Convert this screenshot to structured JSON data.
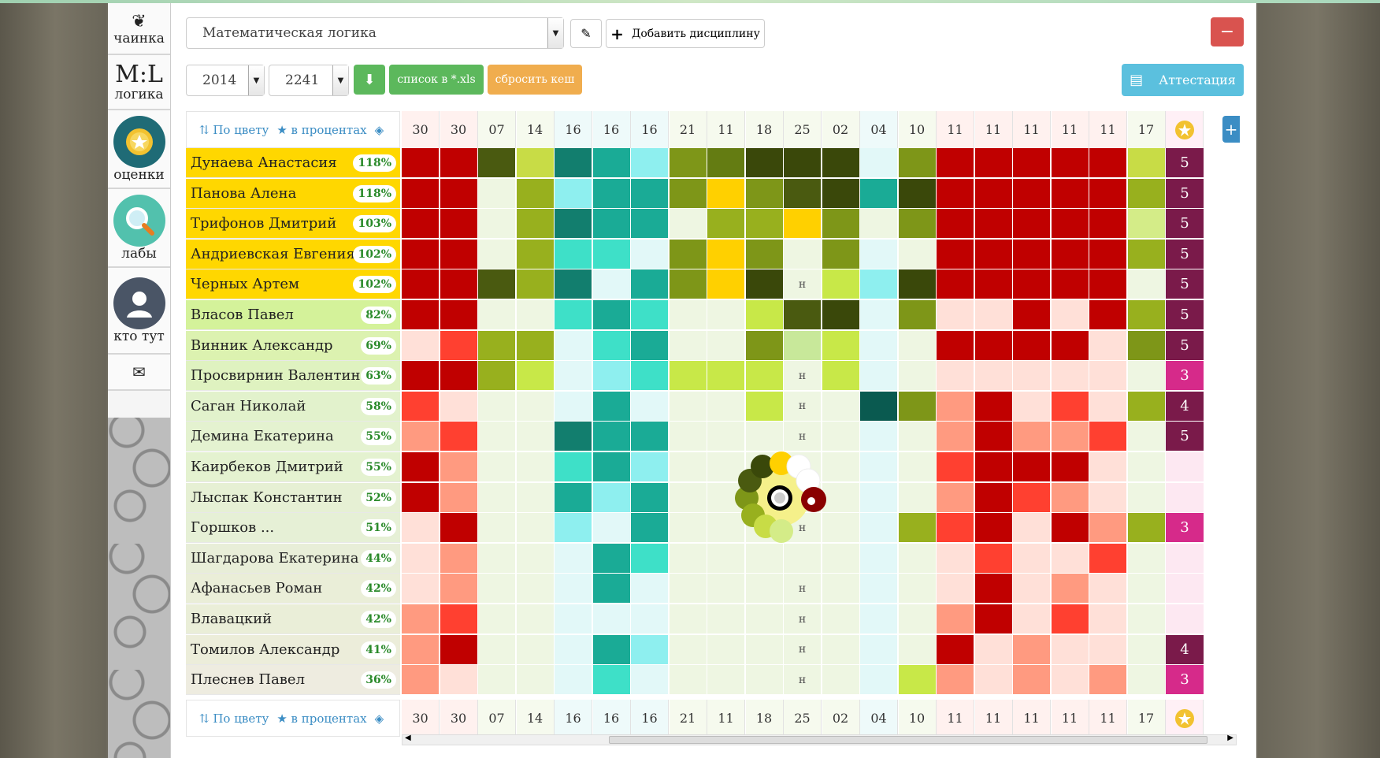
{
  "sidebar": {
    "items": [
      {
        "label": "чаинка",
        "icon": "leaf-icon"
      },
      {
        "label": "логика",
        "logo": "M:L"
      },
      {
        "label": "оценки",
        "icon": "medal-icon"
      },
      {
        "label": "лабы",
        "icon": "magnifier-icon"
      },
      {
        "label": "кто тут",
        "icon": "user-icon"
      },
      {
        "label": "",
        "icon": "mail-icon"
      }
    ]
  },
  "toolbar": {
    "discipline": "Математическая логика",
    "add_discipline": "Добавить дисциплину",
    "remove_label": "−",
    "year": "2014",
    "group": "2241",
    "export_xls": "список в *.xls",
    "reset_cache": "сбросить кеш",
    "attestation": "Аттестация"
  },
  "table_tools": {
    "by_color": "По цвету",
    "in_percent": "в процентах"
  },
  "dates": [
    "30",
    "30",
    "07",
    "14",
    "16",
    "16",
    "16",
    "21",
    "11",
    "18",
    "25",
    "02",
    "04",
    "10",
    "11",
    "11",
    "11",
    "11",
    "11",
    "17"
  ],
  "colors": {
    "accent_green": "#5cb85c",
    "accent_orange": "#f0ad4e",
    "accent_blue": "#5bc0de",
    "danger": "#d9534f",
    "highlight_row": "#ffd700"
  },
  "students": [
    {
      "name": "Дунаева Анастасия",
      "pct": "118%",
      "bg": "#ffd700",
      "final": "5",
      "cells": [
        "#c00000",
        "#c00000",
        "#4a5a10",
        "#c8dc46",
        "#127e6e",
        "#1aab96",
        "#8eefef",
        "#7e9618",
        "#647c12",
        "#3a480a",
        "#3a480a",
        "#3a480a",
        "#e2f8f8",
        "#7e9618",
        "#c00000",
        "#c00000",
        "#c00000",
        "#c00000",
        "#c00000",
        "#c8dc46"
      ],
      "fin": "#7a1a4a"
    },
    {
      "name": "Панова Алена",
      "pct": "118%",
      "bg": "#ffd700",
      "final": "5",
      "cells": [
        "#c00000",
        "#c00000",
        "#eef6e2",
        "#98b01e",
        "#8eefef",
        "#1aab96",
        "#1aab96",
        "#7e9618",
        "#ffd000",
        "#7e9618",
        "#4a5a10",
        "#3a480a",
        "#1aab96",
        "#3a480a",
        "#c00000",
        "#c00000",
        "#c00000",
        "#c00000",
        "#c00000",
        "#98b01e"
      ],
      "fin": "#7a1a4a"
    },
    {
      "name": "Трифонов Дмитрий",
      "pct": "103%",
      "bg": "#ffd700",
      "final": "5",
      "cells": [
        "#c00000",
        "#c00000",
        "#eef6e2",
        "#98b01e",
        "#127e6e",
        "#1aab96",
        "#1aab96",
        "#eef6e2",
        "#98b01e",
        "#98b01e",
        "#ffd000",
        "#7e9618",
        "#eef6e2",
        "#7e9618",
        "#c00000",
        "#c00000",
        "#c00000",
        "#c00000",
        "#c00000",
        "#d4ec88"
      ],
      "fin": "#7a1a4a"
    },
    {
      "name": "Андриевская Евгения",
      "pct": "102%",
      "bg": "#ffd700",
      "final": "5",
      "cells": [
        "#c00000",
        "#c00000",
        "#eef6e2",
        "#98b01e",
        "#3ee0c8",
        "#3ee0c8",
        "#e2f8f8",
        "#7e9618",
        "#ffd000",
        "#7e9618",
        "#eef6e2",
        "#7e9618",
        "#e2f8f8",
        "#eef6e2",
        "#c00000",
        "#c00000",
        "#c00000",
        "#c00000",
        "#c00000",
        "#98b01e"
      ],
      "fin": "#7a1a4a"
    },
    {
      "name": "Черных Артем",
      "pct": "102%",
      "bg": "#ffd700",
      "final": "5",
      "cells": [
        "#c00000",
        "#c00000",
        "#4a5a10",
        "#98b01e",
        "#127e6e",
        "#e2f8f8",
        "#1aab96",
        "#7e9618",
        "#ffd000",
        "#3a480a",
        "н",
        "#c8e848",
        "#8eefef",
        "#3a480a",
        "#c00000",
        "#c00000",
        "#c00000",
        "#c00000",
        "#c00000",
        "#eef6e2"
      ],
      "fin": "#7a1a4a"
    },
    {
      "name": "Власов Павел",
      "pct": "82%",
      "bg": "#d4f29a",
      "final": "5",
      "cells": [
        "#c00000",
        "#c00000",
        "#eef6e2",
        "#eef6e2",
        "#3ee0c8",
        "#1aab96",
        "#3ee0c8",
        "#eef6e2",
        "#eef6e2",
        "#c8e848",
        "#4a5a10",
        "#3a480a",
        "#e2f8f8",
        "#7e9618",
        "#ffe0d8",
        "#ffe0d8",
        "#c00000",
        "#ffe0d8",
        "#c00000",
        "#98b01e"
      ],
      "fin": "#7a1a4a"
    },
    {
      "name": "Винник Александр",
      "pct": "69%",
      "bg": "#dcf2b0",
      "final": "5",
      "cells": [
        "#ffe0d8",
        "#ff4030",
        "#98b01e",
        "#98b01e",
        "#e2f8f8",
        "#3ee0c8",
        "#1aab96",
        "#eef6e2",
        "#eef6e2",
        "#7e9618",
        "#c8e89a",
        "#c8e848",
        "#e2f8f8",
        "#eef6e2",
        "#c00000",
        "#c00000",
        "#c00000",
        "#c00000",
        "#ffe0d8",
        "#7e9618"
      ],
      "fin": "#7a1a4a"
    },
    {
      "name": "Просвирнин Валентин",
      "pct": "63%",
      "bg": "#dff2c0",
      "final": "3",
      "cells": [
        "#c00000",
        "#c00000",
        "#98b01e",
        "#c8e848",
        "#e2f8f8",
        "#8eefef",
        "#3ee0c8",
        "#c8e848",
        "#c8e848",
        "#c8e848",
        "н",
        "#c8e848",
        "#e2f8f8",
        "#eef6e2",
        "#ffe0d8",
        "#ffe0d8",
        "#ffe0d8",
        "#ffe0d8",
        "#ffe0d8",
        "#eef6e2"
      ],
      "fin": "#d62a8a"
    },
    {
      "name": "Саган Николай",
      "pct": "58%",
      "bg": "#e2f2cc",
      "final": "4",
      "cells": [
        "#ff4030",
        "#ffe0d8",
        "#eef6e2",
        "#eef6e2",
        "#e2f8f8",
        "#1aab96",
        "#e2f8f8",
        "#eef6e2",
        "#eef6e2",
        "#c8e848",
        "н",
        "#eef6e2",
        "#0a5a50",
        "#7e9618",
        "#ff9a80",
        "#c00000",
        "#ffe0d8",
        "#ff4030",
        "#ffe0d8",
        "#98b01e"
      ],
      "fin": "#7a1a4a"
    },
    {
      "name": "Демина Екатерина",
      "pct": "55%",
      "bg": "#e4f2d0",
      "final": "5",
      "cells": [
        "#ff9a80",
        "#ff4030",
        "#eef6e2",
        "#eef6e2",
        "#127e6e",
        "#1aab96",
        "#1aab96",
        "#eef6e2",
        "#eef6e2",
        "#eef6e2",
        "н",
        "#eef6e2",
        "#e2f8f8",
        "#eef6e2",
        "#ff9a80",
        "#c00000",
        "#ff9a80",
        "#ff9a80",
        "#ff4030",
        "#eef6e2"
      ],
      "fin": "#7a1a4a"
    },
    {
      "name": "Каирбеков Дмитрий",
      "pct": "55%",
      "bg": "#e4f2d0",
      "final": "",
      "cells": [
        "#c00000",
        "#ff9a80",
        "#eef6e2",
        "#eef6e2",
        "#3ee0c8",
        "#1aab96",
        "#8eefef",
        "#eef6e2",
        "#eef6e2",
        "#eef6e2",
        "н",
        "#eef6e2",
        "#e2f8f8",
        "#eef6e2",
        "#ff4030",
        "#c00000",
        "#c00000",
        "#c00000",
        "#ffe0d8",
        "#eef6e2"
      ],
      "fin": "#fde8f2"
    },
    {
      "name": "Лыспак Константин",
      "pct": "52%",
      "bg": "#e6f0d4",
      "final": "",
      "cells": [
        "#c00000",
        "#ff9a80",
        "#eef6e2",
        "#eef6e2",
        "#1aab96",
        "#8eefef",
        "#1aab96",
        "#eef6e2",
        "#eef6e2",
        "#eef6e2",
        "н",
        "#eef6e2",
        "#e2f8f8",
        "#eef6e2",
        "#ff9a80",
        "#c00000",
        "#ff4030",
        "#ff9a80",
        "#ffe0d8",
        "#eef6e2"
      ],
      "fin": "#fde8f2"
    },
    {
      "name": "Горшков ...",
      "pct": "51%",
      "bg": "#e6f0d6",
      "final": "3",
      "cells": [
        "#ffe0d8",
        "#c00000",
        "#eef6e2",
        "#eef6e2",
        "#8eefef",
        "#e2f8f8",
        "#1aab96",
        "#eef6e2",
        "#eef6e2",
        "#eef6e2",
        "н",
        "#eef6e2",
        "#e2f8f8",
        "#98b01e",
        "#ff4030",
        "#c00000",
        "#ffe0d8",
        "#c00000",
        "#ff9a80",
        "#98b01e"
      ],
      "fin": "#d62a8a"
    },
    {
      "name": "Шагдарова Екатерина",
      "pct": "44%",
      "bg": "#e8eed8",
      "final": "",
      "cells": [
        "#ffe0d8",
        "#ff9a80",
        "#eef6e2",
        "#eef6e2",
        "#e2f8f8",
        "#1aab96",
        "#3ee0c8",
        "#eef6e2",
        "#eef6e2",
        "#eef6e2",
        "#eef6e2",
        "#eef6e2",
        "#e2f8f8",
        "#eef6e2",
        "#ffe0d8",
        "#ff4030",
        "#ffe0d8",
        "#ffe0d8",
        "#ff4030",
        "#eef6e2"
      ],
      "fin": "#fde8f2"
    },
    {
      "name": "Афанасьев Роман",
      "pct": "42%",
      "bg": "#eaeed8",
      "final": "",
      "cells": [
        "#ffe0d8",
        "#ff9a80",
        "#eef6e2",
        "#eef6e2",
        "#e2f8f8",
        "#1aab96",
        "#e2f8f8",
        "#eef6e2",
        "#eef6e2",
        "#eef6e2",
        "н",
        "#eef6e2",
        "#e2f8f8",
        "#eef6e2",
        "#ffe0d8",
        "#c00000",
        "#ffe0d8",
        "#ff9a80",
        "#ffe0d8",
        "#eef6e2"
      ],
      "fin": "#fde8f2"
    },
    {
      "name": "Влавацкий",
      "pct": "42%",
      "bg": "#eaeed8",
      "final": "",
      "cells": [
        "#ff9a80",
        "#ff4030",
        "#eef6e2",
        "#eef6e2",
        "#e2f8f8",
        "#e2f8f8",
        "#e2f8f8",
        "#eef6e2",
        "#eef6e2",
        "#eef6e2",
        "н",
        "#eef6e2",
        "#e2f8f8",
        "#eef6e2",
        "#ff9a80",
        "#c00000",
        "#ffe0d8",
        "#ff4030",
        "#ffe0d8",
        "#eef6e2"
      ],
      "fin": "#fde8f2"
    },
    {
      "name": "Томилов Александр",
      "pct": "41%",
      "bg": "#ecedda",
      "final": "4",
      "cells": [
        "#ff9a80",
        "#c00000",
        "#eef6e2",
        "#eef6e2",
        "#e2f8f8",
        "#1aab96",
        "#8eefef",
        "#eef6e2",
        "#eef6e2",
        "#eef6e2",
        "н",
        "#eef6e2",
        "#e2f8f8",
        "#eef6e2",
        "#c00000",
        "#ffe0d8",
        "#ff9a80",
        "#ffe0d8",
        "#ffe0d8",
        "#eef6e2"
      ],
      "fin": "#7a1a4a"
    },
    {
      "name": "Плеснев Павел",
      "pct": "36%",
      "bg": "#eeece0",
      "final": "3",
      "cells": [
        "#ff9a80",
        "#ffe0d8",
        "#eef6e2",
        "#eef6e2",
        "#e2f8f8",
        "#3ee0c8",
        "#e2f8f8",
        "#eef6e2",
        "#eef6e2",
        "#eef6e2",
        "н",
        "#eef6e2",
        "#e2f8f8",
        "#c8e848",
        "#ff9a80",
        "#ffe0d8",
        "#ff9a80",
        "#ffe0d8",
        "#ff9a80",
        "#eef6e2"
      ],
      "fin": "#d62a8a"
    }
  ],
  "absent_mark": "н"
}
